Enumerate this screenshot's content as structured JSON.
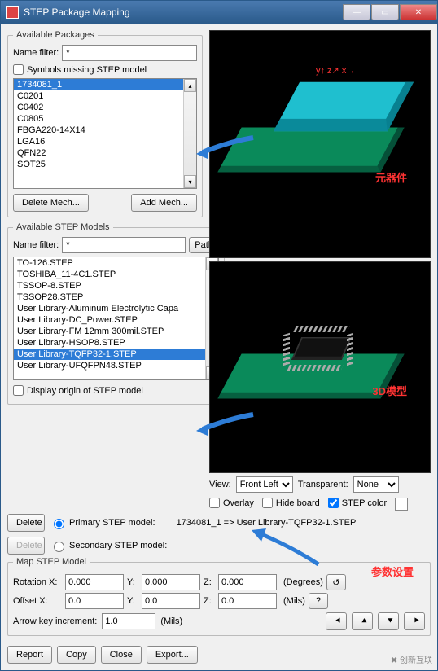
{
  "window": {
    "title": "STEP Package Mapping"
  },
  "availablePackages": {
    "legend": "Available Packages",
    "nameFilterLabel": "Name filter:",
    "nameFilterValue": "*",
    "symbolsMissingLabel": "Symbols missing STEP model",
    "items": [
      "1734081_1",
      "C0201",
      "C0402",
      "C0805",
      "FBGA220-14X14",
      "LGA16",
      "QFN22",
      "SOT25"
    ],
    "selectedIndex": 0,
    "deleteMechLabel": "Delete Mech...",
    "addMechLabel": "Add Mech..."
  },
  "annotations": {
    "component": "元器件",
    "model3d": "3D模型",
    "params": "参数设置"
  },
  "availableModels": {
    "legend": "Available STEP Models",
    "nameFilterLabel": "Name filter:",
    "nameFilterValue": "*",
    "pathLabel": "Path",
    "items": [
      "TO-126.STEP",
      "TOSHIBA_11-4C1.STEP",
      "TSSOP-8.STEP",
      "TSSOP28.STEP",
      "User Library-Aluminum Electrolytic Capa",
      "User Library-DC_Power.STEP",
      "User Library-FM 12mm 300mil.STEP",
      "User Library-HSOP8.STEP",
      "User Library-TQFP32-1.STEP",
      "User Library-UFQFPN48.STEP"
    ],
    "selectedIndex": 8,
    "displayOriginLabel": "Display origin of STEP model"
  },
  "view": {
    "viewLabel": "View:",
    "viewValue": "Front Left",
    "transparentLabel": "Transparent:",
    "transparentValue": "None",
    "overlayLabel": "Overlay",
    "hideBoardLabel": "Hide board",
    "stepColorLabel": "STEP color",
    "stepColorChecked": true
  },
  "mapping": {
    "deleteLabel": "Delete",
    "primaryLabel": "Primary STEP model:",
    "primaryValue": "1734081_1 => User Library-TQFP32-1.STEP",
    "secondaryLabel": "Secondary STEP model:",
    "mapLegend": "Map STEP Model",
    "rotationLabel": "Rotation X:",
    "offsetLabel": "Offset X:",
    "yLabel": "Y:",
    "zLabel": "Z:",
    "rotX": "0.000",
    "rotY": "0.000",
    "rotZ": "0.000",
    "offX": "0.0",
    "offY": "0.0",
    "offZ": "0.0",
    "degreesLabel": "(Degrees)",
    "milsLabel": "(Mils)",
    "arrowIncLabel": "Arrow key increment:",
    "arrowIncValue": "1.0",
    "arrowIncUnit": "(Mils)"
  },
  "footer": {
    "report": "Report",
    "copy": "Copy",
    "close": "Close",
    "export": "Export..."
  }
}
